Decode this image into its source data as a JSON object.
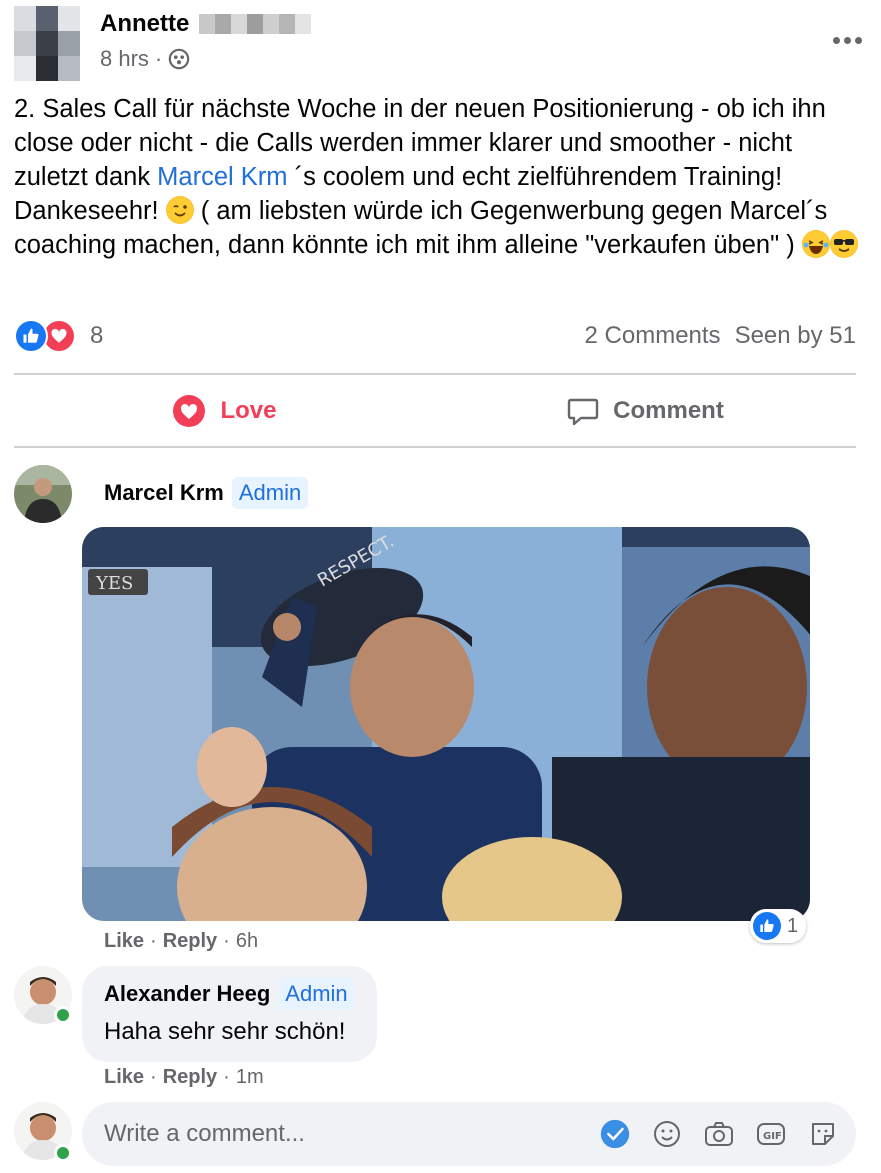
{
  "post": {
    "author_first_name": "Annette",
    "time": "8 hrs",
    "audience_icon": "group-audience-icon",
    "text_part1": "2. Sales Call für nächste Woche in der neuen Positionierung - ob ich ihn close oder nicht - die Calls werden immer klarer und smoother - nicht zuletzt dank ",
    "mention": "Marcel Krm",
    "text_part2": " ´s coolem und echt zielführendem Training! Dankeseehr! ",
    "text_part3": " ( am liebsten würde ich Gegenwerbung gegen Marcel´s coaching machen, dann könnte ich mit ihm alleine \"verkaufen üben\" ) "
  },
  "reactions": {
    "icons": [
      "like-icon",
      "love-icon"
    ],
    "count": "8",
    "comments": "2 Comments",
    "seen_by": "Seen by 51"
  },
  "actions": {
    "love_label": "Love",
    "comment_label": "Comment"
  },
  "comments": [
    {
      "author": "Marcel Krm",
      "badge": "Admin",
      "media": "gif-image",
      "like_label": "Like",
      "reply_label": "Reply",
      "time": "6h",
      "like_count": "1"
    },
    {
      "author": "Alexander Heeg",
      "badge": "Admin",
      "text": "Haha sehr sehr schön!",
      "like_label": "Like",
      "reply_label": "Reply",
      "time": "1m"
    }
  ],
  "composer": {
    "placeholder": "Write a comment...",
    "icons": [
      "checkmark-icon",
      "emoji-icon",
      "camera-icon",
      "gif-icon",
      "sticker-icon"
    ]
  },
  "colors": {
    "accent_blue": "#1877f2",
    "love_red": "#f33e58",
    "mention_blue": "#216fdb",
    "secondary_text": "#65676b",
    "bubble_bg": "#f0f2f5"
  }
}
